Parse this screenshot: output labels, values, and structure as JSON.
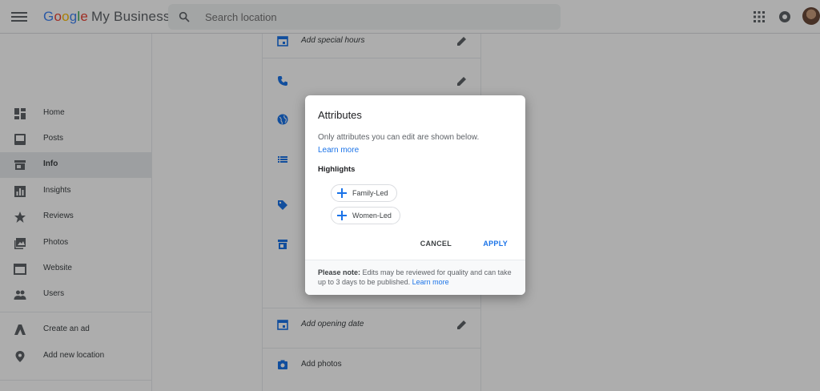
{
  "app": {
    "logo_google": [
      "G",
      "o",
      "o",
      "g",
      "l",
      "e"
    ],
    "logo_suffix": "My Business"
  },
  "search": {
    "placeholder": "Search location"
  },
  "sidebar": {
    "items": [
      {
        "label": "Home",
        "icon": "dashboard-icon"
      },
      {
        "label": "Posts",
        "icon": "posts-icon"
      },
      {
        "label": "Info",
        "icon": "storefront-icon",
        "active": true
      },
      {
        "label": "Insights",
        "icon": "insights-icon"
      },
      {
        "label": "Reviews",
        "icon": "star-icon"
      },
      {
        "label": "Photos",
        "icon": "photos-icon"
      },
      {
        "label": "Website",
        "icon": "website-icon"
      },
      {
        "label": "Users",
        "icon": "users-icon"
      }
    ],
    "secondary": [
      {
        "label": "Create an ad",
        "icon": "ads-icon"
      },
      {
        "label": "Add new location",
        "icon": "location-pin-icon"
      }
    ]
  },
  "content": {
    "special_hours": "Add special hours",
    "opening_date": "Add opening date",
    "photos": "Add photos"
  },
  "dialog": {
    "title": "Attributes",
    "description": "Only attributes you can edit are shown below.",
    "learn_more": "Learn more",
    "section": "Highlights",
    "chips": [
      "Family-Led",
      "Women-Led"
    ],
    "cancel": "CANCEL",
    "apply": "APPLY",
    "note_bold": "Please note:",
    "note_text": " Edits may be reviewed for quality and can take up to 3 days to be published.",
    "note_link": "Learn more"
  },
  "colors": {
    "accent": "#1a73e8",
    "scrim": "rgba(0,0,0,0.32)"
  }
}
